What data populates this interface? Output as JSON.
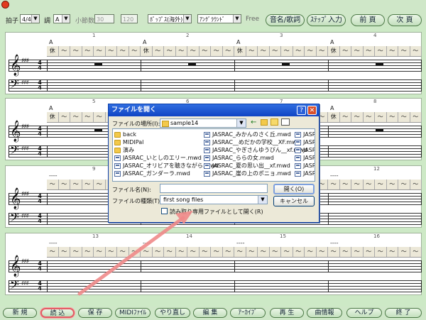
{
  "toolbar": {
    "time_sig_label": "拍子",
    "time_sig_value": "4/4",
    "key_label": "調",
    "key_value": "A",
    "measure_label": "小節数",
    "measure_value": "30",
    "tempo_value": "120",
    "style_value": "ﾎﾟｯﾌﾟｽ(海外)",
    "arrange_value": "ｱﾝｸﾞﾗｳﾝﾄﾞ",
    "free_label": "Free",
    "buttons": [
      "音名/歌詞",
      "ｽﾃｯﾌﾟ入力",
      "前 頁",
      "次 頁"
    ]
  },
  "score": {
    "systems": [
      {
        "measures": [
          "1",
          "2",
          "3",
          "4"
        ],
        "chord": "A",
        "lyrics": [
          "休",
          "～",
          "～",
          "～",
          "～",
          "～",
          "～",
          "～"
        ]
      },
      {
        "measures": [
          "5",
          "6",
          "7",
          "8"
        ],
        "chord": "A",
        "lyrics": [
          "休",
          "～",
          "～",
          "～",
          "～",
          "～",
          "～",
          "～"
        ]
      },
      {
        "measures": [
          "9",
          "10",
          "11",
          "12"
        ],
        "chord": "----",
        "lyrics": [
          "～",
          "～",
          "～",
          "～",
          "～",
          "～",
          "～",
          "～"
        ]
      },
      {
        "measures": [
          "13",
          "14",
          "15",
          "16"
        ],
        "chord": "----",
        "lyrics": [
          "～",
          "～",
          "～",
          "～",
          "～",
          "～",
          "～",
          "～"
        ]
      }
    ],
    "time_sig_top": "4",
    "time_sig_bottom": "4",
    "key_sig": "♯♯♯"
  },
  "dialog": {
    "title": "ファイルを開く",
    "look_in_label": "ファイルの場所(I):",
    "look_in_value": "sample14",
    "files_col1": [
      {
        "name": "back",
        "type": "folder"
      },
      {
        "name": "MIDIPal",
        "type": "folder"
      },
      {
        "name": "演み",
        "type": "folder"
      },
      {
        "name": "JASRAC_いとしのエリー.mwd",
        "type": "doc"
      },
      {
        "name": "JASRAC_オリビアを聴きながら.mwd",
        "type": "doc"
      },
      {
        "name": "JASRAC_ガンダーラ.mwd",
        "type": "doc"
      }
    ],
    "files_col2": [
      {
        "name": "JASRAC_みかんのさく丘.mwd",
        "type": "doc"
      },
      {
        "name": "JASRAC__めだかの学校__XF.mwd",
        "type": "doc"
      },
      {
        "name": "JASRAC_やぎさんゆうびん__xf.mwd",
        "type": "doc"
      },
      {
        "name": "JASRAC_ららの女.mwd",
        "type": "doc"
      },
      {
        "name": "JASRAC_夏の思い出__xf.mwd",
        "type": "doc"
      },
      {
        "name": "JASRAC_崖の上のポニョ.mwd",
        "type": "doc"
      }
    ],
    "files_col3": [
      {
        "name": "JASRA",
        "type": "doc"
      },
      {
        "name": "JASRA",
        "type": "doc"
      },
      {
        "name": "JASRA",
        "type": "doc"
      },
      {
        "name": "JASRA",
        "type": "doc"
      },
      {
        "name": "JASRA",
        "type": "doc"
      },
      {
        "name": "JASR",
        "type": "doc"
      }
    ],
    "filename_label": "ファイル名(N):",
    "filename_value": "",
    "filetype_label": "ファイルの種類(T):",
    "filetype_value": "first song files",
    "open_button": "開く(O)",
    "cancel_button": "キャンセル",
    "readonly_label": "読み取り専用ファイルとして開く(R)"
  },
  "bottom": {
    "buttons": [
      "新 規",
      "読 込",
      "保 存",
      "MIDIﾌｧｲﾙ",
      "やり直し",
      "編 集",
      "ｱｰｶｲﾌﾞ",
      "再 生",
      "曲情報",
      "ヘルプ",
      "終 了"
    ]
  }
}
